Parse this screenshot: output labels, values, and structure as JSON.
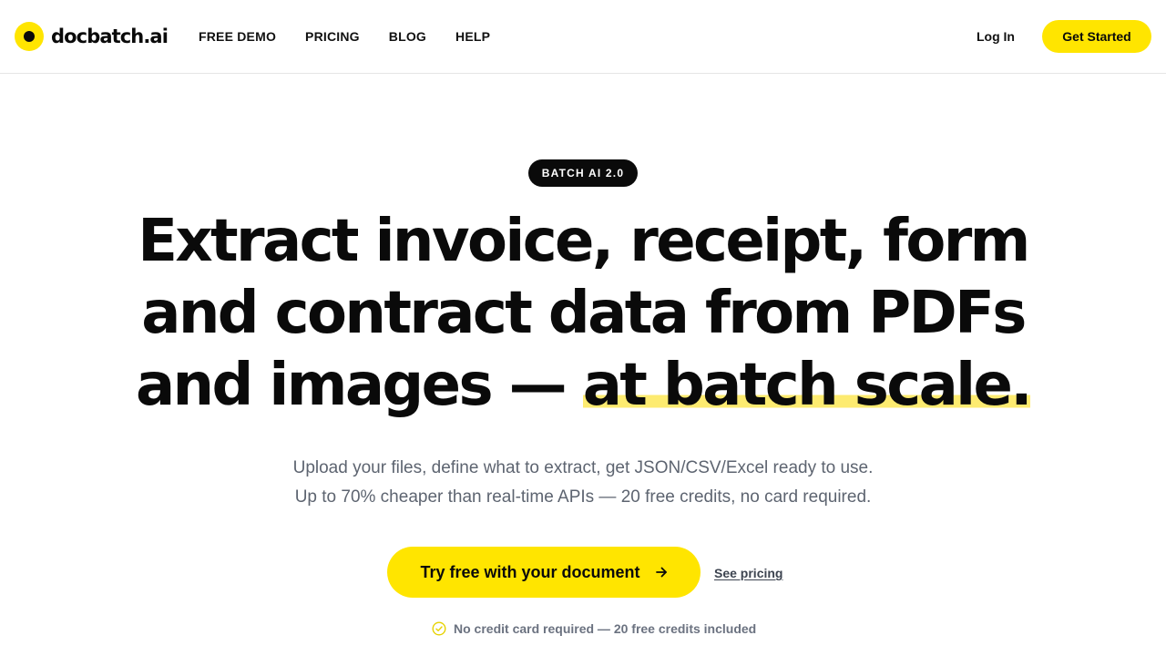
{
  "nav": {
    "logo_text": "docbatch.ai",
    "links": [
      "FREE DEMO",
      "PRICING",
      "BLOG",
      "HELP"
    ],
    "login_label": "Log In",
    "cta_label": "Get Started"
  },
  "hero": {
    "badge": "BATCH AI 2.0",
    "headline_line1": "Extract invoice, receipt, form",
    "headline_line2": "and contract data from PDFs",
    "headline_line3_plain": "and images — ",
    "headline_line3_highlight": "at batch scale.",
    "subtitle_line1": "Upload your files, define what to extract, get JSON/CSV/Excel ready to use.",
    "subtitle_line2": "Up to 70% cheaper than real-time APIs — 20 free credits, no card required.",
    "cta_label": "Try free with your document",
    "secondary_link": "See pricing",
    "note": "No credit card required — 20 free credits included"
  },
  "icons": {
    "cta_icon": "arrow-right-icon",
    "note_icon": "check-circle-icon"
  },
  "colors": {
    "accent": "#ffe500",
    "highlight": "#fdeb70",
    "text": "#0a0a0a",
    "muted": "#5d6470"
  }
}
